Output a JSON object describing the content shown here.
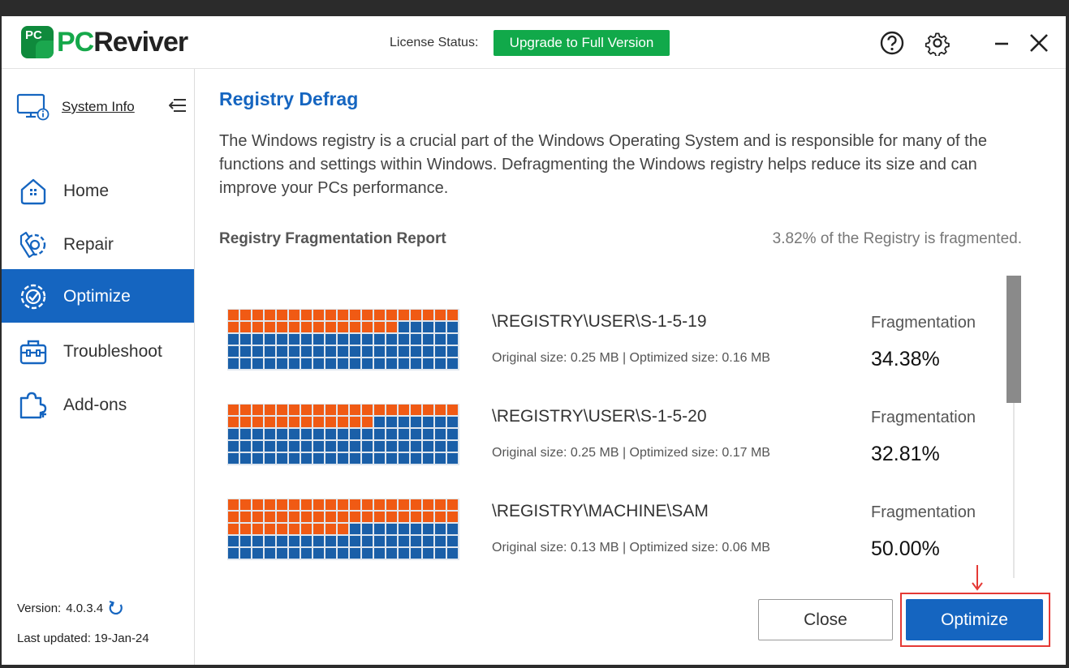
{
  "app": {
    "logo_badge": "PC",
    "logo_pc": "PC",
    "logo_reviver": "Reviver",
    "license_label": "License Status:",
    "upgrade_label": "Upgrade to Full Version"
  },
  "sidebar": {
    "system_info": "System Info",
    "items": [
      {
        "label": "Home",
        "icon": "home-icon"
      },
      {
        "label": "Repair",
        "icon": "wrench-gear-icon"
      },
      {
        "label": "Optimize",
        "icon": "gear-check-icon",
        "active": true
      },
      {
        "label": "Troubleshoot",
        "icon": "toolbox-icon"
      },
      {
        "label": "Add-ons",
        "icon": "puzzle-icon"
      }
    ],
    "version_label": "Version:",
    "version": "4.0.3.4",
    "last_updated": "Last updated: 19-Jan-24"
  },
  "main": {
    "title": "Registry Defrag",
    "description": "The Windows registry is a crucial part of the Windows Operating System and is responsible for many of the functions and settings within Windows. Defragmenting the Windows registry helps reduce its size and can improve your PCs performance.",
    "report_title": "Registry Fragmentation Report",
    "report_summary": "3.82% of the Registry is fragmented.",
    "entries": [
      {
        "key": "\\REGISTRY\\USER\\S-1-5-19",
        "sizes": "Original size: 0.25 MB  |  Optimized size: 0.16 MB",
        "frag_label": "Fragmentation",
        "frag_value": "34.38%",
        "fragmented_fraction": 0.3438
      },
      {
        "key": "\\REGISTRY\\USER\\S-1-5-20",
        "sizes": "Original size: 0.25 MB  |  Optimized size: 0.17 MB",
        "frag_label": "Fragmentation",
        "frag_value": "32.81%",
        "fragmented_fraction": 0.3281
      },
      {
        "key": "\\REGISTRY\\MACHINE\\SAM",
        "sizes": "Original size: 0.13 MB  |  Optimized size: 0.06 MB",
        "frag_label": "Fragmentation",
        "frag_value": "50.00%",
        "fragmented_fraction": 0.5
      }
    ],
    "close_label": "Close",
    "optimize_label": "Optimize"
  },
  "colors": {
    "accent": "#1565c0",
    "upgrade": "#11a94a",
    "fragmented_block": "#f05a14",
    "defragmented_block": "#1a5fa8",
    "highlight": "#e53935"
  }
}
